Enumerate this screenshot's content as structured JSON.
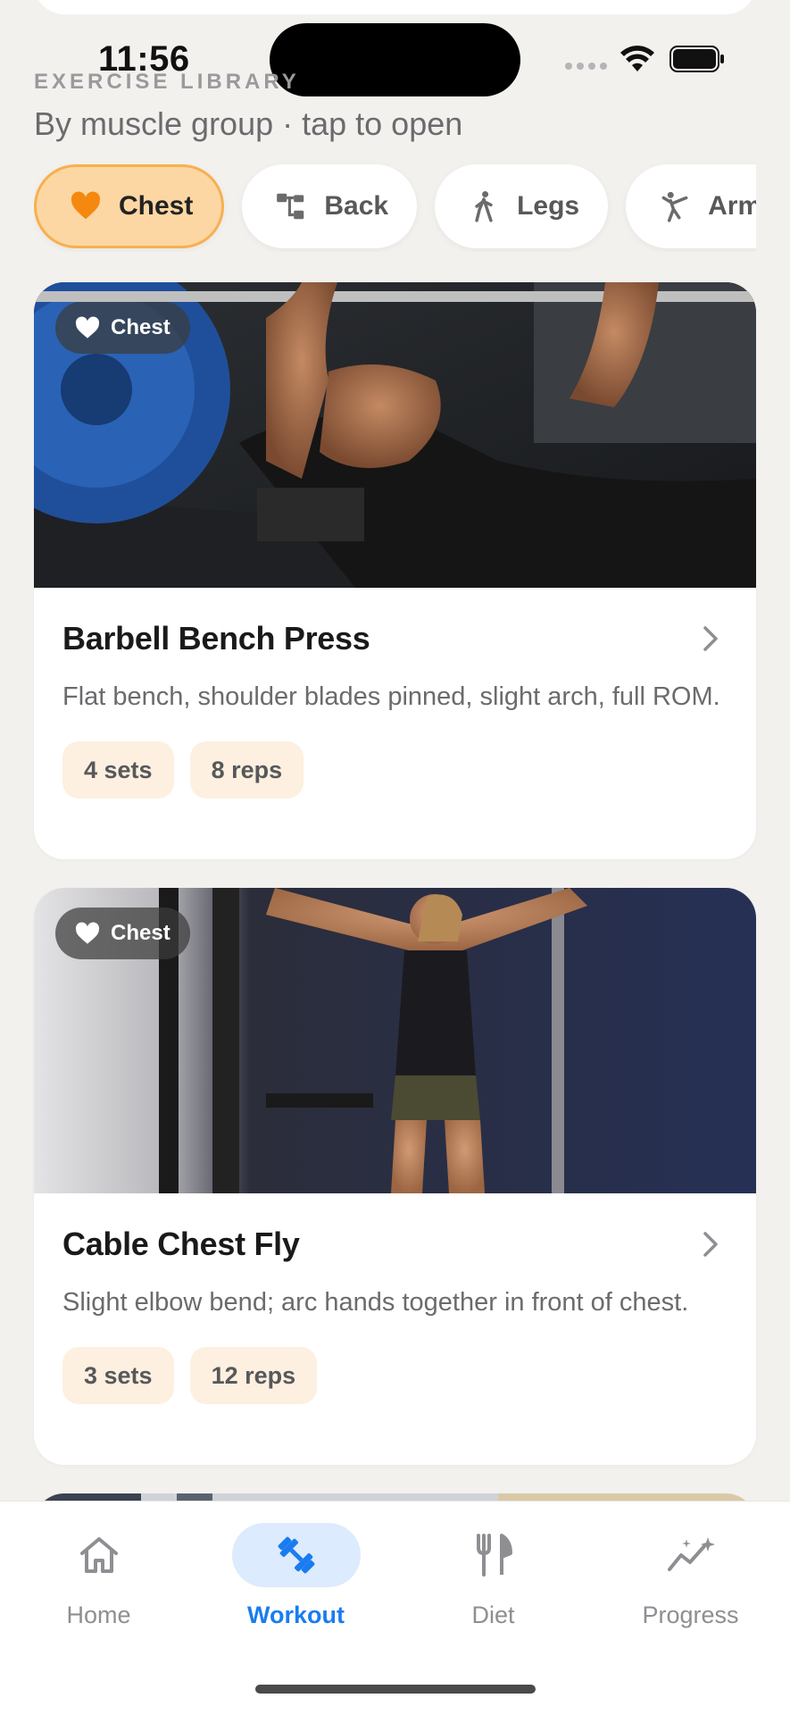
{
  "status_bar": {
    "time": "11:56"
  },
  "library": {
    "eyebrow": "EXERCISE LIBRARY",
    "subtitle": "By muscle group · tap to open"
  },
  "muscle_groups": [
    {
      "label": "Chest",
      "icon": "heart-icon",
      "active": true
    },
    {
      "label": "Back",
      "icon": "hierarchy-icon",
      "active": false
    },
    {
      "label": "Legs",
      "icon": "walking-figure-icon",
      "active": false
    },
    {
      "label": "Arms",
      "icon": "kick-figure-icon",
      "active": false
    }
  ],
  "exercises": [
    {
      "badge": "Chest",
      "name": "Barbell Bench Press",
      "description": "Flat bench, shoulder blades pinned, slight arch, full ROM.",
      "sets": "4 sets",
      "reps": "8 reps",
      "image": "man-bench-press-photo"
    },
    {
      "badge": "Chest",
      "name": "Cable Chest Fly",
      "description": "Slight elbow bend; arc hands together in front of chest.",
      "sets": "3 sets",
      "reps": "12 reps",
      "image": "woman-cable-fly-photo"
    }
  ],
  "tab_bar": {
    "tabs": [
      {
        "label": "Home",
        "icon": "house-icon",
        "active": false
      },
      {
        "label": "Workout",
        "icon": "dumbbell-icon",
        "active": true
      },
      {
        "label": "Diet",
        "icon": "fork-knife-icon",
        "active": false
      },
      {
        "label": "Progress",
        "icon": "trend-sparkle-icon",
        "active": false
      }
    ]
  },
  "colors": {
    "accent": "#1a7cf0",
    "chip_active_bg": "#fcd7a3",
    "chip_active_border": "#f7b04f",
    "heart_orange": "#f5890f",
    "pill_bg": "#fdf0e0",
    "background": "#f3f1ee"
  }
}
